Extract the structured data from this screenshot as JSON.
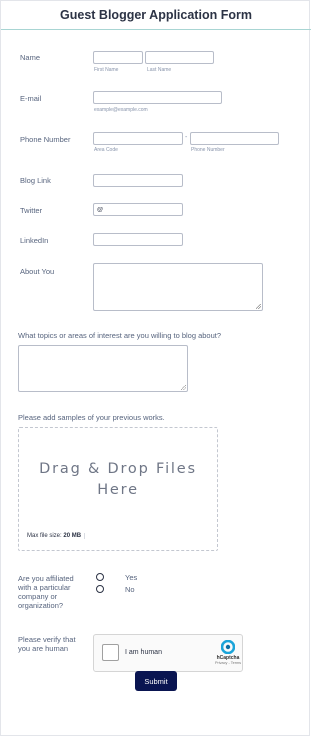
{
  "form": {
    "title": "Guest Blogger Application Form"
  },
  "fields": {
    "name": {
      "label": "Name",
      "first_sub": "First Name",
      "last_sub": "Last Name",
      "first_value": "",
      "last_value": ""
    },
    "email": {
      "label": "E-mail",
      "sub": "example@example.com",
      "value": ""
    },
    "phone": {
      "label": "Phone Number",
      "area_sub": "Area Code",
      "number_sub": "Phone Number",
      "separator": "-",
      "area_value": "",
      "number_value": ""
    },
    "blog": {
      "label": "Blog Link",
      "value": ""
    },
    "twitter": {
      "label": "Twitter",
      "value": "@"
    },
    "linkedin": {
      "label": "LinkedIn",
      "value": ""
    },
    "about": {
      "label": "About You",
      "value": ""
    }
  },
  "topics": {
    "question": "What topics or areas of interest are you willing to blog about?",
    "value": ""
  },
  "samples": {
    "question": "Please add samples of your previous works.",
    "drop_text": "Drag & Drop Files Here",
    "max_label": "Max file size:",
    "max_value": "20 MB"
  },
  "affiliation": {
    "question": "Are you affiliated with a particular company or organization?",
    "options": [
      {
        "label": "Yes",
        "selected": false
      },
      {
        "label": "No",
        "selected": false
      }
    ]
  },
  "verify": {
    "label": "Please verify that you are human",
    "captcha_text": "I am human",
    "captcha_brand": "hCaptcha",
    "captcha_terms": "Privacy - Terms",
    "logo_icon": "hcaptcha-logo-icon",
    "checkbox_icon": "checkbox-icon"
  },
  "submit": {
    "label": "Submit"
  },
  "colors": {
    "submit_bg": "#0a1551",
    "header_border": "#a8d5d3",
    "label_text": "#57647e",
    "input_border": "#b8bdc9",
    "captcha_accent": "#1ba4d9"
  }
}
